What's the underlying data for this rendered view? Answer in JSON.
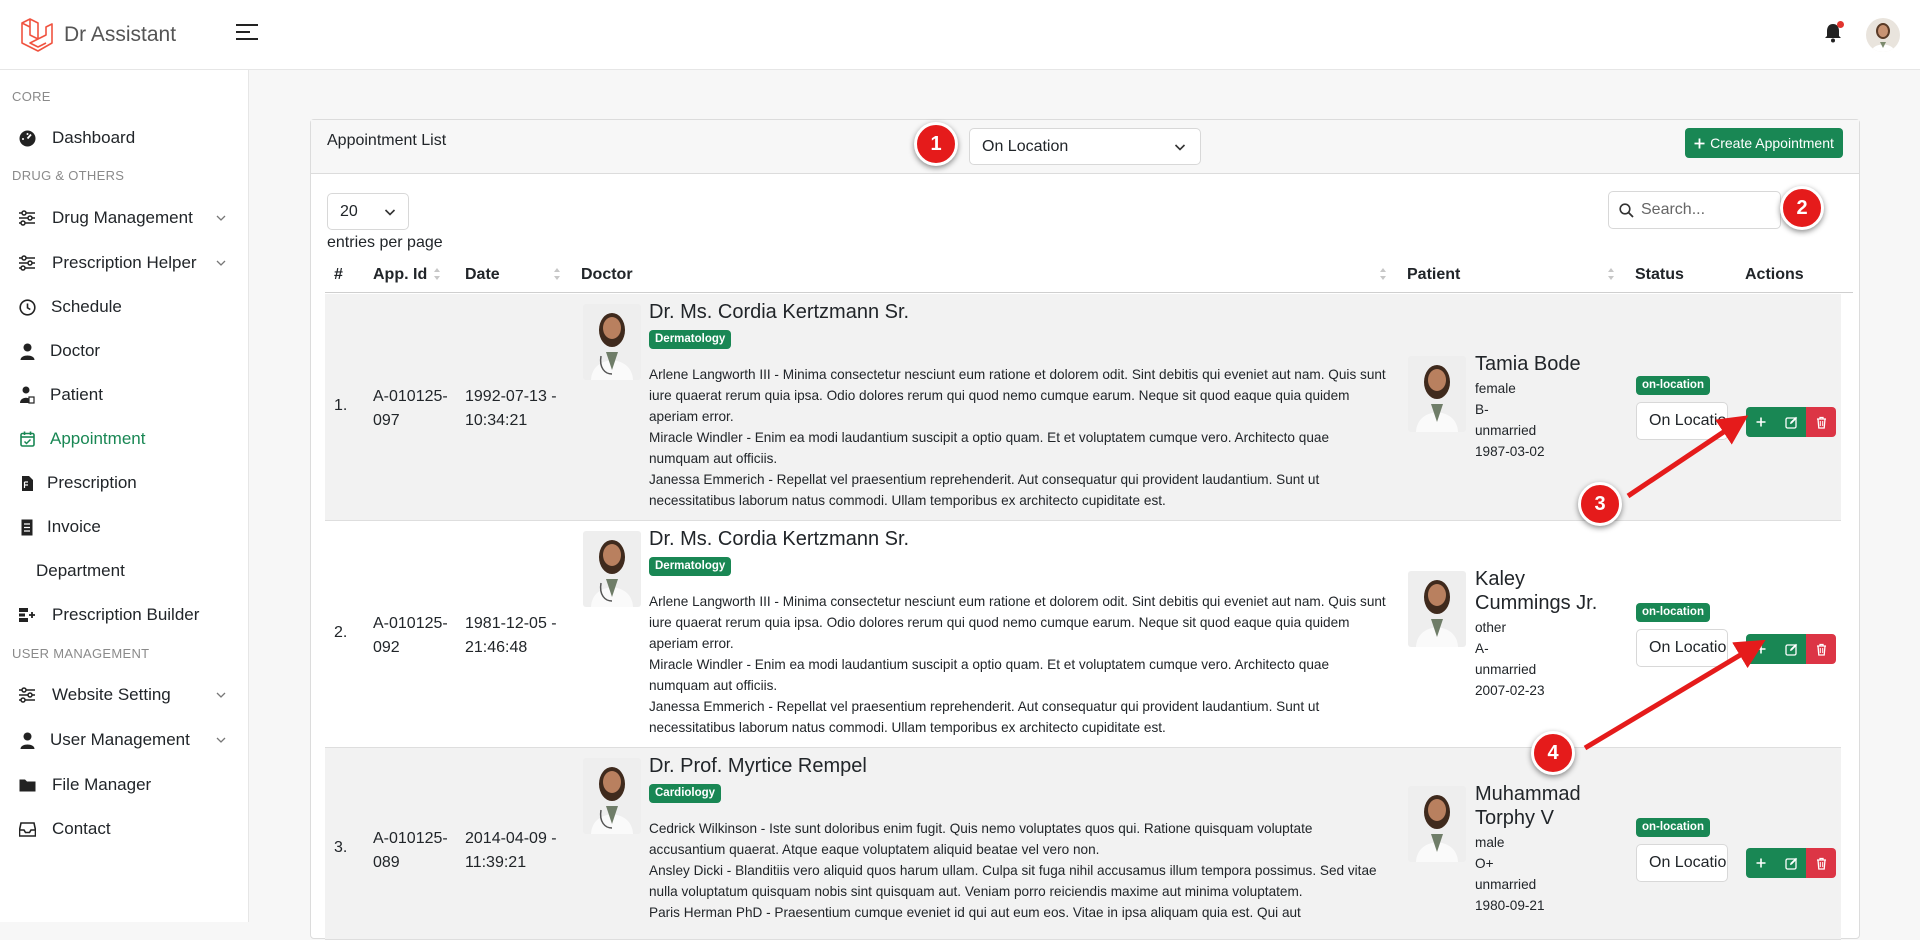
{
  "app": {
    "name": "Dr Assistant"
  },
  "sidebar": {
    "sections": {
      "core": "CORE",
      "drug": "DRUG & OTHERS",
      "user": "USER MANAGEMENT"
    },
    "items": [
      {
        "label": "Dashboard",
        "icon": "dashboard-icon"
      },
      {
        "label": "Drug Management",
        "icon": "sliders-icon"
      },
      {
        "label": "Prescription Helper",
        "icon": "sliders-icon"
      },
      {
        "label": "Schedule",
        "icon": "clock-icon"
      },
      {
        "label": "Doctor",
        "icon": "user-doctor-icon"
      },
      {
        "label": "Patient",
        "icon": "patient-icon"
      },
      {
        "label": "Appointment",
        "icon": "calendar-check-icon"
      },
      {
        "label": "Prescription",
        "icon": "file-prescription-icon"
      },
      {
        "label": "Invoice",
        "icon": "receipt-icon"
      },
      {
        "label": "Department",
        "icon": ""
      },
      {
        "label": "Prescription Builder",
        "icon": "builder-icon"
      },
      {
        "label": "Website Setting",
        "icon": "sliders-icon"
      },
      {
        "label": "User Management",
        "icon": "user-icon"
      },
      {
        "label": "File Manager",
        "icon": "folder-icon"
      },
      {
        "label": "Contact",
        "icon": "inbox-icon"
      }
    ]
  },
  "card": {
    "title": "Appointment List",
    "status_filter": "On Location",
    "create_label": "Create Appointment",
    "per_page": "20",
    "per_page_label": "entries per page",
    "search_placeholder": "Search..."
  },
  "table": {
    "headers": [
      "#",
      "App. Id",
      "Date",
      "Doctor",
      "Patient",
      "Status",
      "Actions"
    ],
    "rows": [
      {
        "num": "1.",
        "app_id": [
          "A-010125-",
          "097"
        ],
        "date": [
          "1992-07-13 -",
          "10:34:21"
        ],
        "doctor": "Dr. Ms. Cordia Kertzmann Sr.",
        "dept": "Dermatology",
        "notes": [
          "Arlene Langworth III - Minima consectetur nesciunt eum ratione et dolorem odit. Sint debitis qui eveniet aut nam. Quis sunt iure quaerat rerum quia ipsa. Odio dolores rerum qui quod nemo cumque earum. Neque sit quod eaque quia quidem aperiam error.",
          "Miracle Windler - Enim ea modi laudantium suscipit a optio quam. Et et voluptatem cumque vero. Architecto quae numquam aut officiis.",
          "Janessa Emmerich - Repellat vel praesentium reprehenderit. Aut consequatur qui provident laudantium. Sunt ut necessitatibus laborum natus commodi. Ullam temporibus ex architecto cupiditate est."
        ],
        "patient": "Tamia Bode",
        "gender": "female",
        "blood": "B-",
        "marital": "unmarried",
        "dob": "1987-03-02",
        "status_badge": "on-location",
        "status_value": "On Location"
      },
      {
        "num": "2.",
        "app_id": [
          "A-010125-",
          "092"
        ],
        "date": [
          "1981-12-05 -",
          "21:46:48"
        ],
        "doctor": "Dr. Ms. Cordia Kertzmann Sr.",
        "dept": "Dermatology",
        "notes": [
          "Arlene Langworth III - Minima consectetur nesciunt eum ratione et dolorem odit. Sint debitis qui eveniet aut nam. Quis sunt iure quaerat rerum quia ipsa. Odio dolores rerum qui quod nemo cumque earum. Neque sit quod eaque quia quidem aperiam error.",
          "Miracle Windler - Enim ea modi laudantium suscipit a optio quam. Et et voluptatem cumque vero. Architecto quae numquam aut officiis.",
          "Janessa Emmerich - Repellat vel praesentium reprehenderit. Aut consequatur qui provident laudantium. Sunt ut necessitatibus laborum natus commodi. Ullam temporibus ex architecto cupiditate est."
        ],
        "patient": "Kaley Cummings Jr.",
        "gender": "other",
        "blood": "A-",
        "marital": "unmarried",
        "dob": "2007-02-23",
        "status_badge": "on-location",
        "status_value": "On Location"
      },
      {
        "num": "3.",
        "app_id": [
          "A-010125-",
          "089"
        ],
        "date": [
          "2014-04-09 -",
          "11:39:21"
        ],
        "doctor": "Dr. Prof. Myrtice Rempel",
        "dept": "Cardiology",
        "notes": [
          "Cedrick Wilkinson - Iste sunt doloribus enim fugit. Quis nemo voluptates quos qui. Ratione quisquam voluptate accusantium quaerat. Atque eaque voluptatem aliquid beatae vel vero non.",
          "Ansley Dicki - Blanditiis vero aliquid quos harum ullam. Culpa sit fuga nihil accusamus illum tempora possimus. Sed vitae nulla voluptatum quisquam nobis sint quisquam aut. Veniam porro reiciendis maxime aut minima voluptatem.",
          "Paris Herman PhD - Praesentium cumque eveniet id qui aut eum eos. Vitae in ipsa aliquam quia est. Qui aut"
        ],
        "patient": "Muhammad Torphy V",
        "gender": "male",
        "blood": "O+",
        "marital": "unmarried",
        "dob": "1980-09-21",
        "status_badge": "on-location",
        "status_value": "On Location"
      }
    ]
  },
  "markers": [
    "1",
    "2",
    "3",
    "4"
  ],
  "colors": {
    "primary": "#198754",
    "danger": "#dc3545",
    "marker": "#e51b1b"
  }
}
